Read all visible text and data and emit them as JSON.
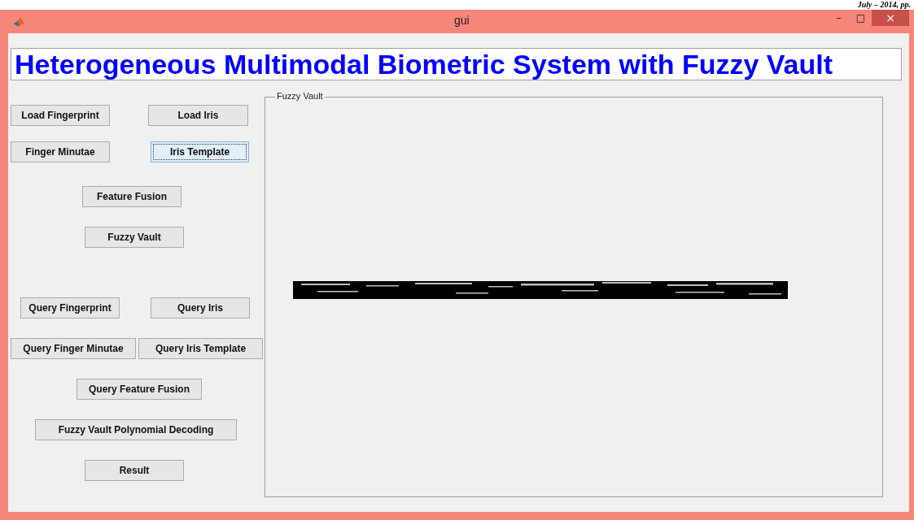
{
  "page_header_fragment": "July – 2014, pp.",
  "window": {
    "title": "gui",
    "controls": [
      "–",
      "□",
      "×"
    ]
  },
  "heading": "Heterogeneous Multimodal Biometric System with Fuzzy Vault",
  "button_rows": [
    {
      "buttons": [
        {
          "label": "Load Fingerprint",
          "focused": false
        },
        {
          "label": "Load Iris",
          "focused": false
        }
      ]
    },
    {
      "buttons": [
        {
          "label": "Finger Minutae",
          "focused": false
        },
        {
          "label": "Iris Template",
          "focused": true
        }
      ]
    },
    {
      "buttons": [
        {
          "label": "Feature Fusion",
          "focused": false
        }
      ]
    },
    {
      "buttons": [
        {
          "label": "Fuzzy Vault",
          "focused": false
        }
      ]
    },
    {
      "buttons": [
        {
          "label": "Query Fingerprint",
          "focused": false
        },
        {
          "label": "Query Iris",
          "focused": false
        }
      ]
    },
    {
      "buttons": [
        {
          "label": "Query Finger Minutae",
          "focused": false
        },
        {
          "label": "Query Iris Template",
          "focused": false
        }
      ]
    },
    {
      "buttons": [
        {
          "label": "Query Feature Fusion",
          "focused": false
        }
      ]
    },
    {
      "buttons": [
        {
          "label": "Fuzzy Vault Polynomial Decoding",
          "focused": false
        }
      ]
    },
    {
      "buttons": [
        {
          "label": "Result",
          "focused": false
        }
      ]
    }
  ],
  "panel": {
    "title": "Fuzzy Vault"
  }
}
